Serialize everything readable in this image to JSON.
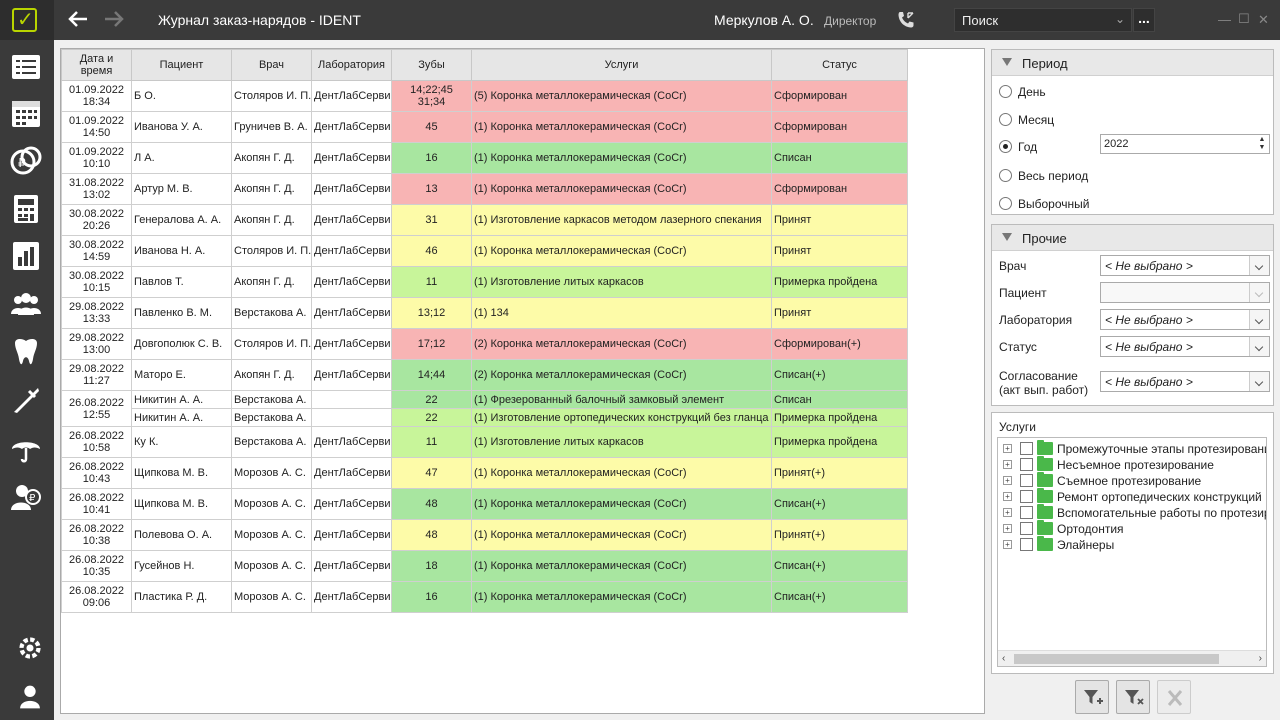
{
  "topbar": {
    "title": "Журнал заказ-нарядов",
    "separator": "-",
    "app_name": "IDENT",
    "user_name": "Меркулов А. О.",
    "user_role": "Директор",
    "search_placeholder": "Поиск",
    "search_more": "..."
  },
  "sidebar": {
    "items": [
      "journal-icon",
      "calendar-icon",
      "payments-icon",
      "calculator-icon",
      "reports-icon",
      "patients-icon",
      "tooth-icon",
      "instruments-icon",
      "insurance-icon",
      "cashier-icon"
    ],
    "bottom": [
      "settings-icon",
      "user-icon"
    ]
  },
  "table": {
    "columns": [
      "Дата и\nвремя",
      "Пациент",
      "Врач",
      "Лаборатория",
      "Зубы",
      "Услуги",
      "Статус"
    ],
    "rows": [
      {
        "date": "01.09.2022",
        "time": "18:34",
        "patient": "Б О.",
        "doctor": "Столяров И. П.",
        "lab": "ДентЛабСервис",
        "teeth": "14;22;45\n31;34",
        "service": "(5) Коронка металлокерамическая (CoCr)",
        "status": "Сформирован",
        "color": "red"
      },
      {
        "date": "01.09.2022",
        "time": "14:50",
        "patient": "Иванова У. А.",
        "doctor": "Груничев В. А.",
        "lab": "ДентЛабСервис",
        "teeth": "45",
        "service": "(1) Коронка металлокерамическая (CoCr)",
        "status": "Сформирован",
        "color": "red"
      },
      {
        "date": "01.09.2022",
        "time": "10:10",
        "patient": "Л А.",
        "doctor": "Акопян Г. Д.",
        "lab": "ДентЛабСервис",
        "teeth": "16",
        "service": "(1) Коронка металлокерамическая (CoCr)",
        "status": "Списан",
        "color": "green"
      },
      {
        "date": "31.08.2022",
        "time": "13:02",
        "patient": "Артур М. В.",
        "doctor": "Акопян Г. Д.",
        "lab": "ДентЛабСервис",
        "teeth": "13",
        "service": "(1) Коронка металлокерамическая (CoCr)",
        "status": "Сформирован",
        "color": "red"
      },
      {
        "date": "30.08.2022",
        "time": "20:26",
        "patient": "Генералова А. А.",
        "doctor": "Акопян Г. Д.",
        "lab": "ДентЛабСервис",
        "teeth": "31",
        "service": "(1) Изготовление каркасов методом лазерного спекания",
        "status": "Принят",
        "color": "yellow"
      },
      {
        "date": "30.08.2022",
        "time": "14:59",
        "patient": "Иванова Н. А.",
        "doctor": "Столяров И. П.",
        "lab": "ДентЛабСервис",
        "teeth": "46",
        "service": "(1) Коронка металлокерамическая (CoCr)",
        "status": "Принят",
        "color": "yellow"
      },
      {
        "date": "30.08.2022",
        "time": "10:15",
        "patient": "Павлов Т.",
        "doctor": "Акопян Г. Д.",
        "lab": "ДентЛабСервис",
        "teeth": "11",
        "service": "(1) Изготовление литых каркасов",
        "status": "Примерка пройдена",
        "color": "lgreen"
      },
      {
        "date": "29.08.2022",
        "time": "13:33",
        "patient": "Павленко В. М.",
        "doctor": "Верстакова А.",
        "lab": "ДентЛабСервис",
        "teeth": "13;12",
        "service": "(1) 134",
        "status": "Принят",
        "color": "yellow"
      },
      {
        "date": "29.08.2022",
        "time": "13:00",
        "patient": "Довгополюк С. В.",
        "doctor": "Столяров И. П.",
        "lab": "ДентЛабСервис",
        "teeth": "17;12",
        "service": "(2) Коронка металлокерамическая (CoCr)",
        "status": "Сформирован(+)",
        "color": "red"
      },
      {
        "date": "29.08.2022",
        "time": "11:27",
        "patient": "Маторо Е.",
        "doctor": "Акопян Г. Д.",
        "lab": "ДентЛабСервис",
        "teeth": "14;44",
        "service": "(2) Коронка металлокерамическая (CoCr)",
        "status": "Списан(+)",
        "color": "green"
      }
    ],
    "merged": {
      "date": "26.08.2022",
      "time": "12:55",
      "rows": [
        {
          "patient": "Никитин А. А.",
          "doctor": "Верстакова А.",
          "lab": "",
          "teeth": "22",
          "service": "(1) Фрезерованный балочный замковый элемент",
          "status": "Списан",
          "color": "green"
        },
        {
          "patient": "Никитин А. А.",
          "doctor": "Верстакова А.",
          "lab": "",
          "teeth": "22",
          "service": "(1) Изготовление ортопедических конструкций без гланца",
          "status": "Примерка пройдена",
          "color": "lgreen"
        }
      ]
    },
    "rows2": [
      {
        "date": "26.08.2022",
        "time": "10:58",
        "patient": "Ку К.",
        "doctor": "Верстакова А.",
        "lab": "ДентЛабСервис",
        "teeth": "11",
        "service": "(1) Изготовление литых каркасов",
        "status": "Примерка пройдена",
        "color": "lgreen"
      },
      {
        "date": "26.08.2022",
        "time": "10:43",
        "patient": "Щипкова М. В.",
        "doctor": "Морозов А. С.",
        "lab": "ДентЛабСервис",
        "teeth": "47",
        "service": "(1) Коронка металлокерамическая (CoCr)",
        "status": "Принят(+)",
        "color": "yellow"
      },
      {
        "date": "26.08.2022",
        "time": "10:41",
        "patient": "Щипкова М. В.",
        "doctor": "Морозов А. С.",
        "lab": "ДентЛабСервис",
        "teeth": "48",
        "service": "(1) Коронка металлокерамическая (CoCr)",
        "status": "Списан(+)",
        "color": "green"
      },
      {
        "date": "26.08.2022",
        "time": "10:38",
        "patient": "Полевова О. А.",
        "doctor": "Морозов А. С.",
        "lab": "ДентЛабСервис",
        "teeth": "48",
        "service": "(1) Коронка металлокерамическая (CoCr)",
        "status": "Принят(+)",
        "color": "yellow"
      },
      {
        "date": "26.08.2022",
        "time": "10:35",
        "patient": "Гусейнов Н.",
        "doctor": "Морозов А. С.",
        "lab": "ДентЛабСервис",
        "teeth": "18",
        "service": "(1) Коронка металлокерамическая (CoCr)",
        "status": "Списан(+)",
        "color": "green"
      },
      {
        "date": "26.08.2022",
        "time": "09:06",
        "patient": "Пластика Р. Д.",
        "doctor": "Морозов А. С.",
        "lab": "ДентЛабСервис",
        "teeth": "16",
        "service": "(1) Коронка металлокерамическая (CoCr)",
        "status": "Списан(+)",
        "color": "green"
      }
    ]
  },
  "period": {
    "title": "Период",
    "options": [
      "День",
      "Месяц",
      "Год",
      "Весь период",
      "Выборочный"
    ],
    "selected": "Год",
    "year": "2022"
  },
  "other": {
    "title": "Прочие",
    "filters": [
      {
        "label": "Врач",
        "value": "< Не выбрано >"
      },
      {
        "label": "Пациент",
        "value": ""
      },
      {
        "label": "Лаборатория",
        "value": "< Не выбрано >"
      },
      {
        "label": "Статус",
        "value": "< Не выбрано >"
      },
      {
        "label": "Согласование\n(акт вып. работ)",
        "value": "< Не выбрано >"
      }
    ]
  },
  "services": {
    "title": "Услуги",
    "items": [
      "Промежуточные этапы протезирования",
      "Несъемное протезирование",
      "Съемное протезирование",
      "Ремонт ортопедических конструкций",
      "Вспомогательные работы по протезированию",
      "Ортодонтия",
      "Элайнеры"
    ]
  },
  "colors": {
    "red": "#f8b4b4",
    "green": "#a8e6a0",
    "yellow": "#fdfba8",
    "lgreen": "#c8f59a",
    "accent": "#b9d500"
  }
}
